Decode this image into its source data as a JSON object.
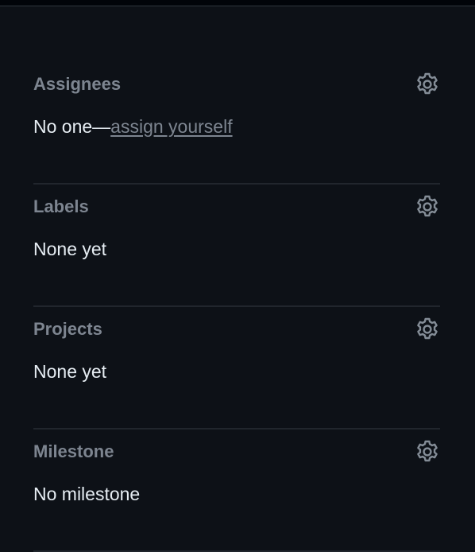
{
  "sidebar": {
    "assignees": {
      "heading": "Assignees",
      "value_prefix": "No one—",
      "link_label": "assign yourself",
      "icon": "gear-icon"
    },
    "labels": {
      "heading": "Labels",
      "value": "None yet",
      "icon": "gear-icon"
    },
    "projects": {
      "heading": "Projects",
      "value": "None yet",
      "icon": "gear-icon"
    },
    "milestone": {
      "heading": "Milestone",
      "value": "No milestone",
      "icon": "gear-icon"
    }
  },
  "colors": {
    "background": "#0d1117",
    "heading": "#7d8590",
    "text": "#e6edf3",
    "divider": "#21262d"
  }
}
